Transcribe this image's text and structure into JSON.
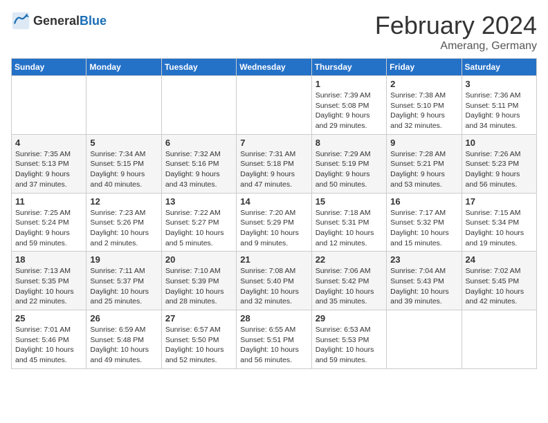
{
  "header": {
    "logo_general": "General",
    "logo_blue": "Blue",
    "month_title": "February 2024",
    "location": "Amerang, Germany"
  },
  "days_of_week": [
    "Sunday",
    "Monday",
    "Tuesday",
    "Wednesday",
    "Thursday",
    "Friday",
    "Saturday"
  ],
  "weeks": [
    [
      {
        "day": "",
        "info": ""
      },
      {
        "day": "",
        "info": ""
      },
      {
        "day": "",
        "info": ""
      },
      {
        "day": "",
        "info": ""
      },
      {
        "day": "1",
        "info": "Sunrise: 7:39 AM\nSunset: 5:08 PM\nDaylight: 9 hours and 29 minutes."
      },
      {
        "day": "2",
        "info": "Sunrise: 7:38 AM\nSunset: 5:10 PM\nDaylight: 9 hours and 32 minutes."
      },
      {
        "day": "3",
        "info": "Sunrise: 7:36 AM\nSunset: 5:11 PM\nDaylight: 9 hours and 34 minutes."
      }
    ],
    [
      {
        "day": "4",
        "info": "Sunrise: 7:35 AM\nSunset: 5:13 PM\nDaylight: 9 hours and 37 minutes."
      },
      {
        "day": "5",
        "info": "Sunrise: 7:34 AM\nSunset: 5:15 PM\nDaylight: 9 hours and 40 minutes."
      },
      {
        "day": "6",
        "info": "Sunrise: 7:32 AM\nSunset: 5:16 PM\nDaylight: 9 hours and 43 minutes."
      },
      {
        "day": "7",
        "info": "Sunrise: 7:31 AM\nSunset: 5:18 PM\nDaylight: 9 hours and 47 minutes."
      },
      {
        "day": "8",
        "info": "Sunrise: 7:29 AM\nSunset: 5:19 PM\nDaylight: 9 hours and 50 minutes."
      },
      {
        "day": "9",
        "info": "Sunrise: 7:28 AM\nSunset: 5:21 PM\nDaylight: 9 hours and 53 minutes."
      },
      {
        "day": "10",
        "info": "Sunrise: 7:26 AM\nSunset: 5:23 PM\nDaylight: 9 hours and 56 minutes."
      }
    ],
    [
      {
        "day": "11",
        "info": "Sunrise: 7:25 AM\nSunset: 5:24 PM\nDaylight: 9 hours and 59 minutes."
      },
      {
        "day": "12",
        "info": "Sunrise: 7:23 AM\nSunset: 5:26 PM\nDaylight: 10 hours and 2 minutes."
      },
      {
        "day": "13",
        "info": "Sunrise: 7:22 AM\nSunset: 5:27 PM\nDaylight: 10 hours and 5 minutes."
      },
      {
        "day": "14",
        "info": "Sunrise: 7:20 AM\nSunset: 5:29 PM\nDaylight: 10 hours and 9 minutes."
      },
      {
        "day": "15",
        "info": "Sunrise: 7:18 AM\nSunset: 5:31 PM\nDaylight: 10 hours and 12 minutes."
      },
      {
        "day": "16",
        "info": "Sunrise: 7:17 AM\nSunset: 5:32 PM\nDaylight: 10 hours and 15 minutes."
      },
      {
        "day": "17",
        "info": "Sunrise: 7:15 AM\nSunset: 5:34 PM\nDaylight: 10 hours and 19 minutes."
      }
    ],
    [
      {
        "day": "18",
        "info": "Sunrise: 7:13 AM\nSunset: 5:35 PM\nDaylight: 10 hours and 22 minutes."
      },
      {
        "day": "19",
        "info": "Sunrise: 7:11 AM\nSunset: 5:37 PM\nDaylight: 10 hours and 25 minutes."
      },
      {
        "day": "20",
        "info": "Sunrise: 7:10 AM\nSunset: 5:39 PM\nDaylight: 10 hours and 28 minutes."
      },
      {
        "day": "21",
        "info": "Sunrise: 7:08 AM\nSunset: 5:40 PM\nDaylight: 10 hours and 32 minutes."
      },
      {
        "day": "22",
        "info": "Sunrise: 7:06 AM\nSunset: 5:42 PM\nDaylight: 10 hours and 35 minutes."
      },
      {
        "day": "23",
        "info": "Sunrise: 7:04 AM\nSunset: 5:43 PM\nDaylight: 10 hours and 39 minutes."
      },
      {
        "day": "24",
        "info": "Sunrise: 7:02 AM\nSunset: 5:45 PM\nDaylight: 10 hours and 42 minutes."
      }
    ],
    [
      {
        "day": "25",
        "info": "Sunrise: 7:01 AM\nSunset: 5:46 PM\nDaylight: 10 hours and 45 minutes."
      },
      {
        "day": "26",
        "info": "Sunrise: 6:59 AM\nSunset: 5:48 PM\nDaylight: 10 hours and 49 minutes."
      },
      {
        "day": "27",
        "info": "Sunrise: 6:57 AM\nSunset: 5:50 PM\nDaylight: 10 hours and 52 minutes."
      },
      {
        "day": "28",
        "info": "Sunrise: 6:55 AM\nSunset: 5:51 PM\nDaylight: 10 hours and 56 minutes."
      },
      {
        "day": "29",
        "info": "Sunrise: 6:53 AM\nSunset: 5:53 PM\nDaylight: 10 hours and 59 minutes."
      },
      {
        "day": "",
        "info": ""
      },
      {
        "day": "",
        "info": ""
      }
    ]
  ]
}
